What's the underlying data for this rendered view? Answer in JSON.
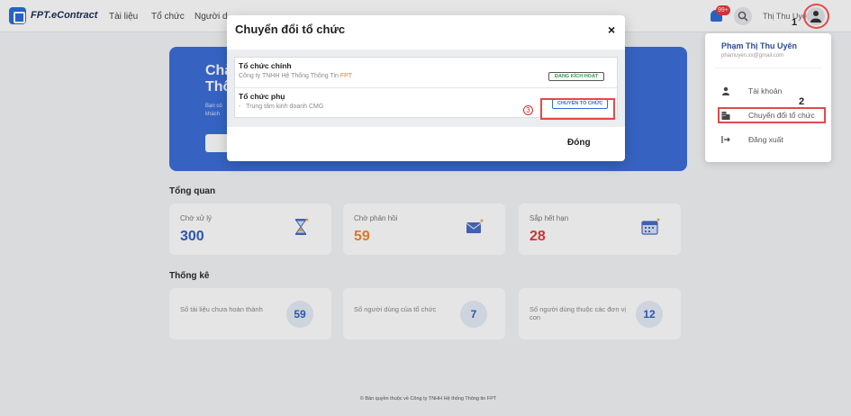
{
  "header": {
    "logo_text": "FPT.eContract",
    "nav": [
      "Tài liệu",
      "Tổ chức",
      "Người d"
    ],
    "notification_badge": "99+",
    "user_name": "Thị Thu Uyên"
  },
  "banner": {
    "title": "Chà Thô",
    "desc": "Bạn có khách"
  },
  "overview": {
    "title": "Tổng quan",
    "cards": [
      {
        "label": "Chờ xử lý",
        "value": "300",
        "color": "#3160c2",
        "icon": "hourglass-icon"
      },
      {
        "label": "Chờ phản hồi",
        "value": "59",
        "color": "#f08a2c",
        "icon": "mail-icon"
      },
      {
        "label": "Sắp hết hạn",
        "value": "28",
        "color": "#e23b3b",
        "icon": "calendar-icon"
      }
    ]
  },
  "stats": {
    "title": "Thống kê",
    "cards": [
      {
        "label": "Số tài liệu chưa hoàn thành",
        "value": "59"
      },
      {
        "label": "Số người dùng của tổ chức",
        "value": "7"
      },
      {
        "label": "Số người dùng thuộc các đơn vị con",
        "value": "12"
      }
    ]
  },
  "footer": {
    "text": "© Bản quyền thuộc về Công ty TNHH Hệ thống Thông tin FPT"
  },
  "dropdown": {
    "name": "Phạm Thị Thu Uyên",
    "email": "phamuyen.xx@gmail.com",
    "items": [
      {
        "label": "Tài khoản",
        "icon": "user-icon"
      },
      {
        "label": "Chuyển đổi tổ chức",
        "icon": "building-icon"
      },
      {
        "label": "Đăng xuất",
        "icon": "logout-icon"
      }
    ]
  },
  "modal": {
    "title": "Chuyển đổi tổ chức",
    "close_symbol": "×",
    "main_org": {
      "title": "Tổ chức chính",
      "name": "Công ty TNHH Hệ Thống Thông Tin",
      "suffix": "FPT",
      "status": "ĐANG KÍCH HOẠT"
    },
    "sub_org": {
      "title": "Tổ chức phụ",
      "prefix": "-",
      "name": "Trung tâm kinh doanh CMG",
      "action": "CHUYỂN TỔ CHỨC"
    },
    "close_button": "Đóng"
  },
  "annotations": {
    "step1": "1",
    "step2": "2",
    "step3": "3"
  }
}
